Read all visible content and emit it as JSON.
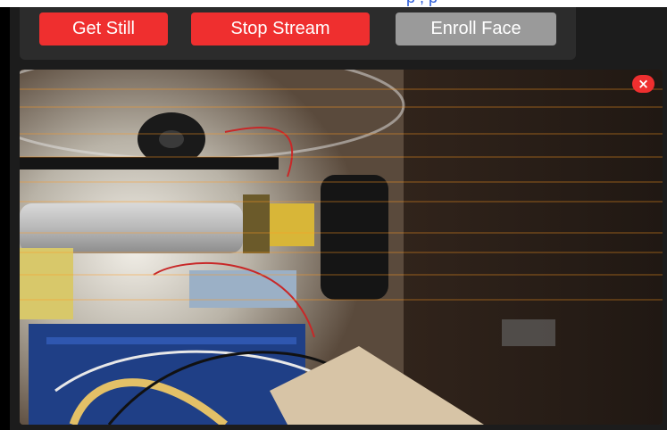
{
  "header_fragment": {
    "text": "p      ,      p"
  },
  "toolbar": {
    "get_still_label": "Get Still",
    "stop_stream_label": "Stop Stream",
    "enroll_face_label": "Enroll Face"
  },
  "viewer": {
    "close_glyph": "×",
    "image_subject": "camera stream"
  },
  "colors": {
    "accent_red": "#ef2f2f",
    "button_gray": "#9a9a9a",
    "panel_bg": "#2c2c2c",
    "page_bg": "#1c1c1c",
    "link_blue": "#2a5bd7"
  },
  "icons": {
    "close": "close-icon"
  }
}
